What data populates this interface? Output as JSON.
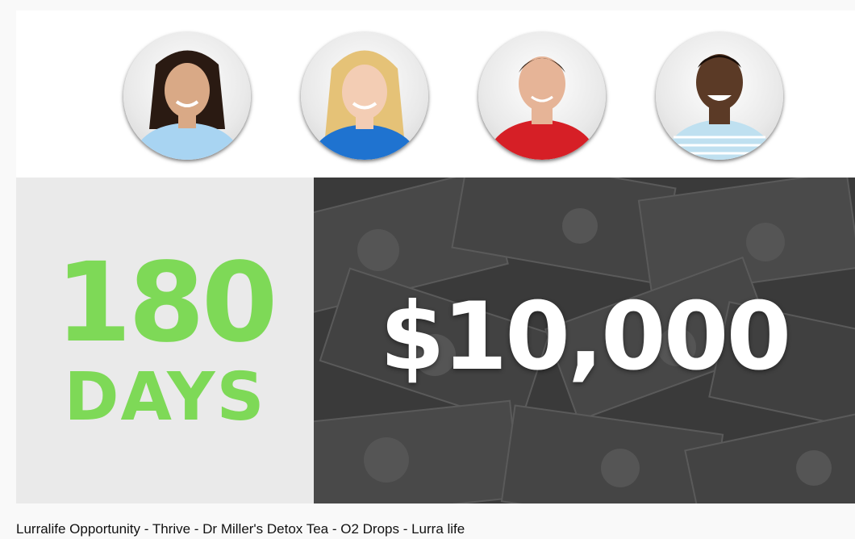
{
  "thumbnail": {
    "headline_number": "180",
    "headline_unit": "DAYS",
    "amount": "$10,000",
    "accent_color": "#7ed957",
    "avatars": [
      {
        "icon": "woman-avatar-1",
        "shirt": "#a8d4f2",
        "hair": "#2a1a12",
        "skin": "#d9a986"
      },
      {
        "icon": "woman-avatar-2",
        "shirt": "#1f73d0",
        "hair": "#e5c277",
        "skin": "#f3cdb4"
      },
      {
        "icon": "man-avatar-1",
        "shirt": "#d61f26",
        "hair": "#3b2a1e",
        "skin": "#e6b497"
      },
      {
        "icon": "man-avatar-2",
        "shirt": "#bfe0f0",
        "hair": "#1a0e08",
        "skin": "#5b3a26"
      }
    ]
  },
  "video": {
    "title": "Lurralife Opportunity - Thrive - Dr Miller's Detox Tea - O2 Drops - Lurra life"
  }
}
